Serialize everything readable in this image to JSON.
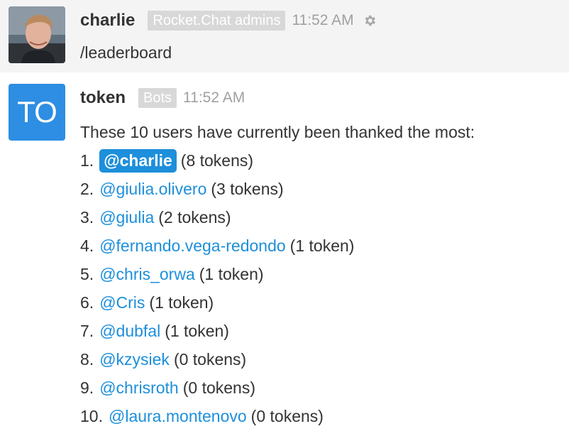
{
  "messages": [
    {
      "username": "charlie",
      "role_badge": "Rocket.Chat admins",
      "time": "11:52 AM",
      "text": "/leaderboard",
      "avatar_icon": "user-photo",
      "actions_icon": "gear-icon"
    },
    {
      "avatar_initials": "TO",
      "avatar_color": "#2d8ee3",
      "username": "token",
      "role_badge": "Bots",
      "time": "11:52 AM",
      "intro": "These 10 users have currently been thanked the most:",
      "leaderboard": [
        {
          "rank": "1.",
          "user": "@charlie",
          "count": "(8 tokens)"
        },
        {
          "rank": "2.",
          "user": "@giulia.olivero",
          "count": "(3 tokens)"
        },
        {
          "rank": "3.",
          "user": "@giulia",
          "count": "(2 tokens)"
        },
        {
          "rank": "4.",
          "user": "@fernando.vega-redondo",
          "count": "(1 token)"
        },
        {
          "rank": "5.",
          "user": "@chris_orwa",
          "count": "(1 token)"
        },
        {
          "rank": "6.",
          "user": "@Cris",
          "count": "(1 token)"
        },
        {
          "rank": "7.",
          "user": "@dubfal",
          "count": "(1 token)"
        },
        {
          "rank": "8.",
          "user": "@kzysiek",
          "count": "(0 tokens)"
        },
        {
          "rank": "9.",
          "user": "@chrisroth",
          "count": "(0 tokens)"
        },
        {
          "rank": "10.",
          "user": "@laura.montenovo",
          "count": "(0 tokens)"
        }
      ]
    }
  ],
  "colors": {
    "mention": "#1d8fdb",
    "highlight_bg": "#1d8fdb",
    "badge_bg": "#d8d8d8"
  }
}
